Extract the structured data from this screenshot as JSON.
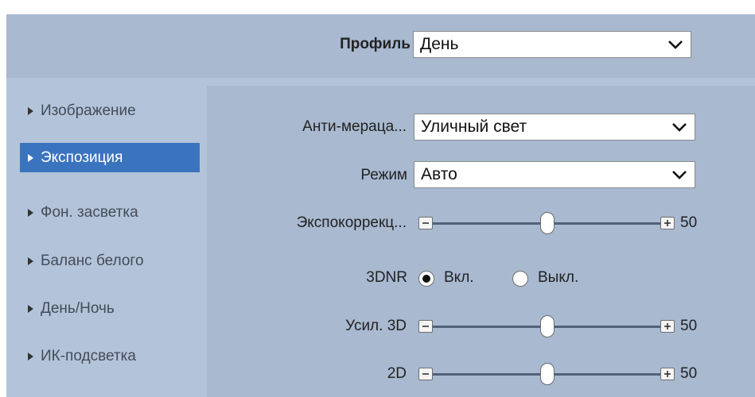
{
  "profile": {
    "label": "Профиль",
    "value": "День"
  },
  "sidebar": {
    "items": [
      {
        "label": "Изображение",
        "active": false
      },
      {
        "label": "Экспозиция",
        "active": true
      },
      {
        "label": "Фон. засветка",
        "active": false
      },
      {
        "label": "Баланс белого",
        "active": false
      },
      {
        "label": "День/Ночь",
        "active": false
      },
      {
        "label": "ИК-подсветка",
        "active": false
      }
    ]
  },
  "exposure": {
    "anti_flicker": {
      "label": "Анти-мераца...",
      "value": "Уличный свет"
    },
    "mode": {
      "label": "Режим",
      "value": "Авто"
    },
    "exposure_comp": {
      "label": "Экспокоррекц...",
      "value": "50"
    },
    "dnr3": {
      "label": "3DNR",
      "on_label": "Вкл.",
      "off_label": "Выкл.",
      "selected": "on"
    },
    "gain_3d": {
      "label": "Усил. 3D",
      "value": "50"
    },
    "dnr_2d": {
      "label": "2D",
      "value": "50"
    }
  },
  "icons": {
    "chevron": "chevron-down-icon",
    "minus": "minus-icon",
    "plus": "plus-icon",
    "side_arrow": "triangle-right-icon"
  },
  "colors": {
    "panel_bg": "#b3c3d9",
    "content_bg": "#a8b9d0",
    "active_item": "#3a74bf",
    "slider_track": "#52617a"
  }
}
